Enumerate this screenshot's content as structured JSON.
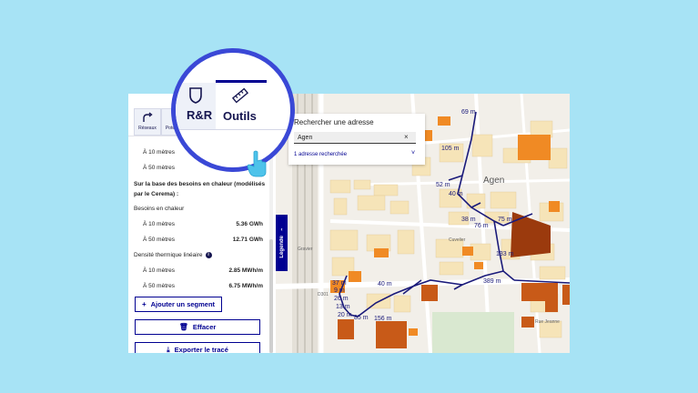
{
  "sidebar": {
    "tabs": [
      {
        "label": "Réseaux",
        "icon": "network-icon"
      },
      {
        "label": "Pote",
        "icon": "potential-icon"
      }
    ],
    "rows_top": [
      {
        "label": "À 10 mètres"
      },
      {
        "label": "À 50 mètres"
      }
    ],
    "section_title": "Sur la base des besoins en chaleur (modélisés par le Cerema) :",
    "besoins_label": "Besoins en chaleur",
    "besoins": [
      {
        "label": "À 10 mètres",
        "value": "5.36 GWh"
      },
      {
        "label": "À 50 mètres",
        "value": "12.71 GWh"
      }
    ],
    "densite_label": "Densité thermique linéaire",
    "densite_info": "i",
    "densite": [
      {
        "label": "À 10 mètres",
        "value": "2.85 MWh/m"
      },
      {
        "label": "À 50 mètres",
        "value": "6.75 MWh/m"
      }
    ],
    "buttons": {
      "add_segment": "Ajouter un segment",
      "clear": "Effacer",
      "export": "Exporter le tracé"
    }
  },
  "magnifier": {
    "tab_rr": "R&R",
    "tab_outils": "Outils"
  },
  "search": {
    "title": "Rechercher une adresse",
    "value": "Agen",
    "clear": "×",
    "result_count": "1 adresse recherchée",
    "chevron": "˅"
  },
  "legend_tab": {
    "label": "Légende",
    "chevron": "‹"
  },
  "map": {
    "city": "Agen",
    "street_labels": [
      "Gravier",
      "Cuvelier",
      "D301",
      "Rue Jeanne"
    ],
    "distance_labels": [
      "69 m",
      "105 m",
      "52 m",
      "40 m",
      "38 m",
      "76 m",
      "75 m",
      "133 m",
      "389 m",
      "40 m",
      "37 m",
      "9 m",
      "26 m",
      "13 m",
      "20 m",
      "85 m",
      "156 m"
    ],
    "colors": {
      "network_line": "#1a1a7a",
      "building_orange": "#f08a24",
      "building_light": "#f6c58a",
      "building_dark": "#a0350e",
      "road": "#ffffff",
      "park": "#d9e8d0"
    }
  }
}
